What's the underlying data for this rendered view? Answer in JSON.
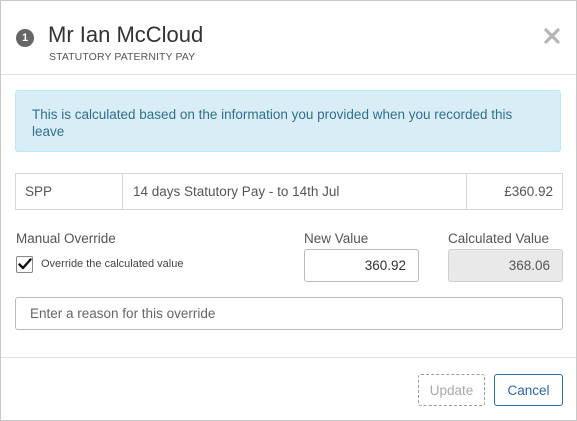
{
  "dialog": {
    "step_number": "1",
    "title": "Mr Ian McCloud",
    "subtitle": "STATUTORY PATERNITY PAY",
    "close_icon": "close-icon"
  },
  "info_message": "This is calculated based on the information you provided when you recorded this leave",
  "pay_line": {
    "code": "SPP",
    "description": "14 days Statutory Pay - to 14th Jul",
    "amount": "£360.92"
  },
  "override": {
    "section_label": "Manual Override",
    "checkbox_label": "Override the calculated value",
    "checkbox_checked": true,
    "new_value_label": "New Value",
    "new_value": "360.92",
    "calculated_value_label": "Calculated Value",
    "calculated_value": "368.06",
    "reason_placeholder": "Enter a reason for this override",
    "reason_value": ""
  },
  "footer": {
    "update_label": "Update",
    "cancel_label": "Cancel"
  },
  "colors": {
    "info_background": "#d9edf7",
    "info_text": "#31708f",
    "cancel_border": "#2e6da4",
    "badge_background": "#666666"
  }
}
